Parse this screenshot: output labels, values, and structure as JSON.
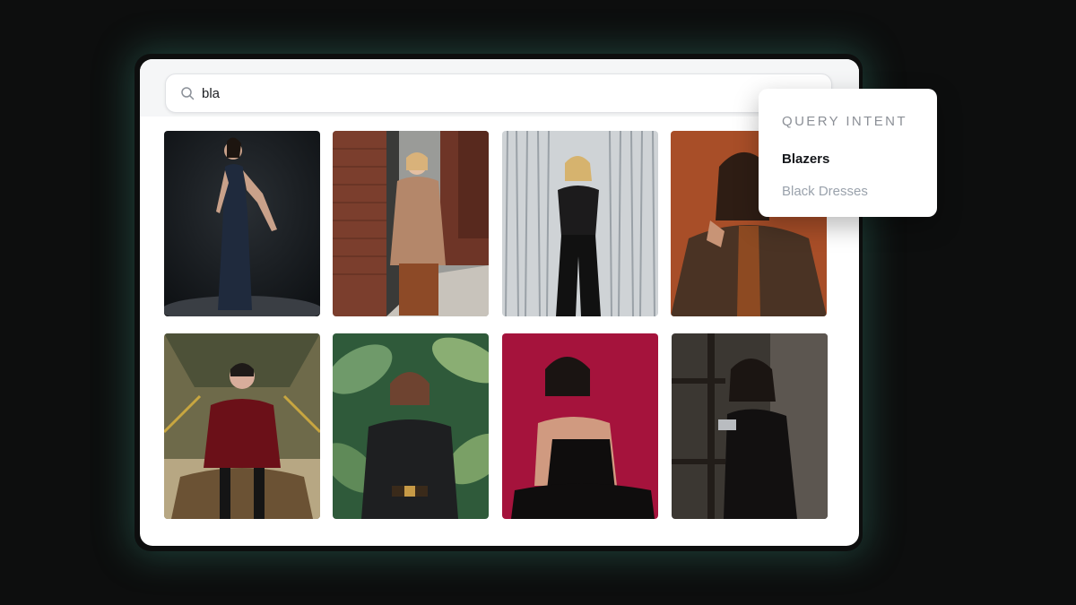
{
  "search": {
    "value": "bla",
    "icon": "search-icon"
  },
  "query_intent": {
    "heading": "QUERY INTENT",
    "items": [
      {
        "label": "Blazers",
        "state": "highlighted"
      },
      {
        "label": "Black Dresses",
        "state": "muted"
      }
    ]
  },
  "results": [
    {
      "kind": "photo",
      "subject": "woman in sequined black gown on dark studio background"
    },
    {
      "kind": "photo",
      "subject": "woman in camel blazer by brick wall"
    },
    {
      "kind": "photo",
      "subject": "woman in black lace top in front of silver tinsel"
    },
    {
      "kind": "photo",
      "subject": "woman in brown coat on rust background"
    },
    {
      "kind": "photo",
      "subject": "woman in burgundy blazer seated in glass room"
    },
    {
      "kind": "photo",
      "subject": "woman in black blazer among banana leaves"
    },
    {
      "kind": "photo",
      "subject": "woman in black slip dress on crimson background"
    },
    {
      "kind": "photo",
      "subject": "woman in black lace dress by wooden ladder"
    }
  ],
  "colors": {
    "page_background": "#0d0e0e",
    "card_glow": "#3c9682",
    "dropdown_active": "#15171b",
    "dropdown_muted": "#9aa2ac"
  }
}
